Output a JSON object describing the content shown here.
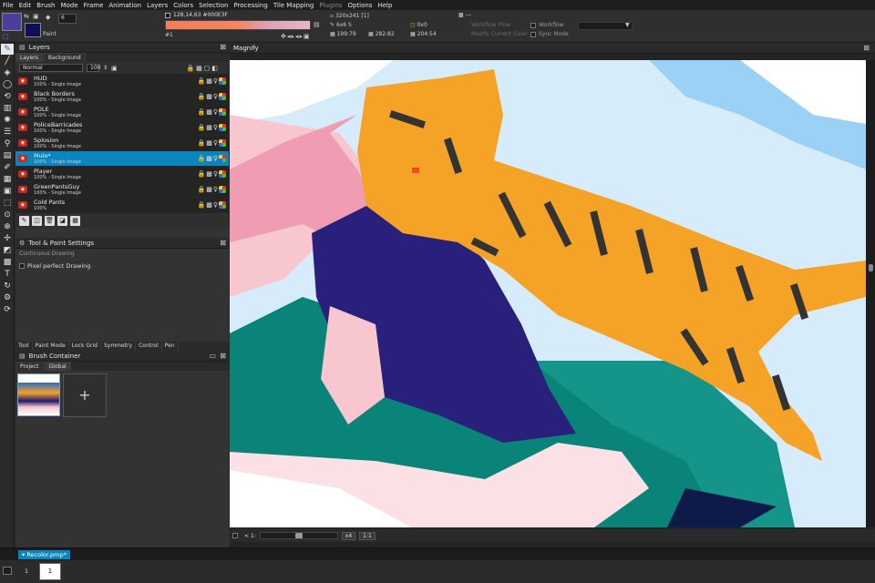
{
  "menu": [
    "File",
    "Edit",
    "Brush",
    "Mode",
    "Frame",
    "Animation",
    "Layers",
    "Colors",
    "Selection",
    "Processing",
    "Tile Mapping",
    "Plugins",
    "Options",
    "Help"
  ],
  "toolbar": {
    "mode_value": "6",
    "paint_label": "Paint",
    "color_info": "128,14,63 #000E3F",
    "palette_index": "#1",
    "image_size": "320x241 [1]",
    "brush_size": "6x6 S",
    "cursor_pos": "199:79",
    "offset": "0x0",
    "sel_a": "282:82",
    "sel_b": "204:54",
    "option_a": "Workflow",
    "option_b": "Sync Mode",
    "gray_a": "Workflow Flow",
    "gray_b": "Modify Current Color",
    "dash": "---"
  },
  "layers_panel": {
    "title": "Layers",
    "tabs": [
      "Layers",
      "Background"
    ],
    "blend_mode": "Normal",
    "opacity": "100",
    "items": [
      {
        "name": "HUD",
        "sub": "100% - Single Image",
        "selected": false
      },
      {
        "name": "Black Borders",
        "sub": "100% - Single Image",
        "selected": false
      },
      {
        "name": "POLE",
        "sub": "100% - Single Image",
        "selected": false
      },
      {
        "name": "PoliceBarricades",
        "sub": "100% - Single Image",
        "selected": false
      },
      {
        "name": "Splosion",
        "sub": "100% - Single Image",
        "selected": false
      },
      {
        "name": "Mule*",
        "sub": "100% - Single Image",
        "selected": true
      },
      {
        "name": "Player",
        "sub": "100% - Single Image",
        "selected": false
      },
      {
        "name": "GreenPantsGuy",
        "sub": "100% - Single Image",
        "selected": false
      },
      {
        "name": "Cold Pants",
        "sub": "100%",
        "selected": false
      }
    ]
  },
  "tool_settings": {
    "title": "Tool & Paint Settings",
    "subtitle": "Continuous Drawing",
    "pixel_perfect_label": "Pixel perfect Drawing",
    "tabs": [
      "Tool",
      "Paint Mode",
      "Lock Grid",
      "Symmetry",
      "Control",
      "Pen"
    ]
  },
  "brush_container": {
    "title": "Brush Container",
    "tabs": [
      "Project",
      "Global"
    ],
    "add_label": "+"
  },
  "magnify": {
    "title": "Magnify",
    "zoom_label": "x4",
    "ratio_label": "1:1",
    "prev_label": "< 1:"
  },
  "document": {
    "tab_label": "Recolor.pmp*",
    "frame_number": "1",
    "frame_thumb": "1"
  },
  "colors": {
    "foreground": "#4c3e9d",
    "background": "#0e0e5a",
    "accent": "#0a85be",
    "sky": "#9bd1f5",
    "tiger": "#f5a326",
    "hair": "#28207a",
    "teal": "#0a8478",
    "skin": "#f7c6cf"
  }
}
